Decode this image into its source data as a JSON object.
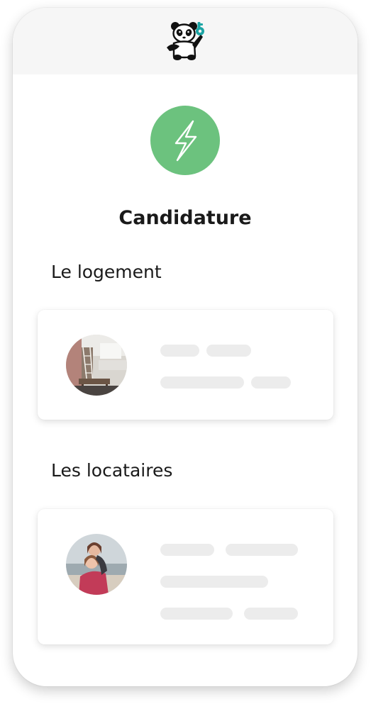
{
  "header": {
    "logo": "panda-holding-key-logo"
  },
  "status_icon": "lightning-bolt-icon",
  "colors": {
    "accent_green": "#6cc27e",
    "key_teal": "#1ba4a4",
    "skeleton_gray": "#ececec",
    "header_gray": "#f6f6f6"
  },
  "page": {
    "title": "Candidature"
  },
  "sections": {
    "logement": {
      "title": "Le logement",
      "image": "apartment-interior-photo"
    },
    "locataires": {
      "title": "Les locataires",
      "image": "tenants-couple-photo"
    }
  }
}
